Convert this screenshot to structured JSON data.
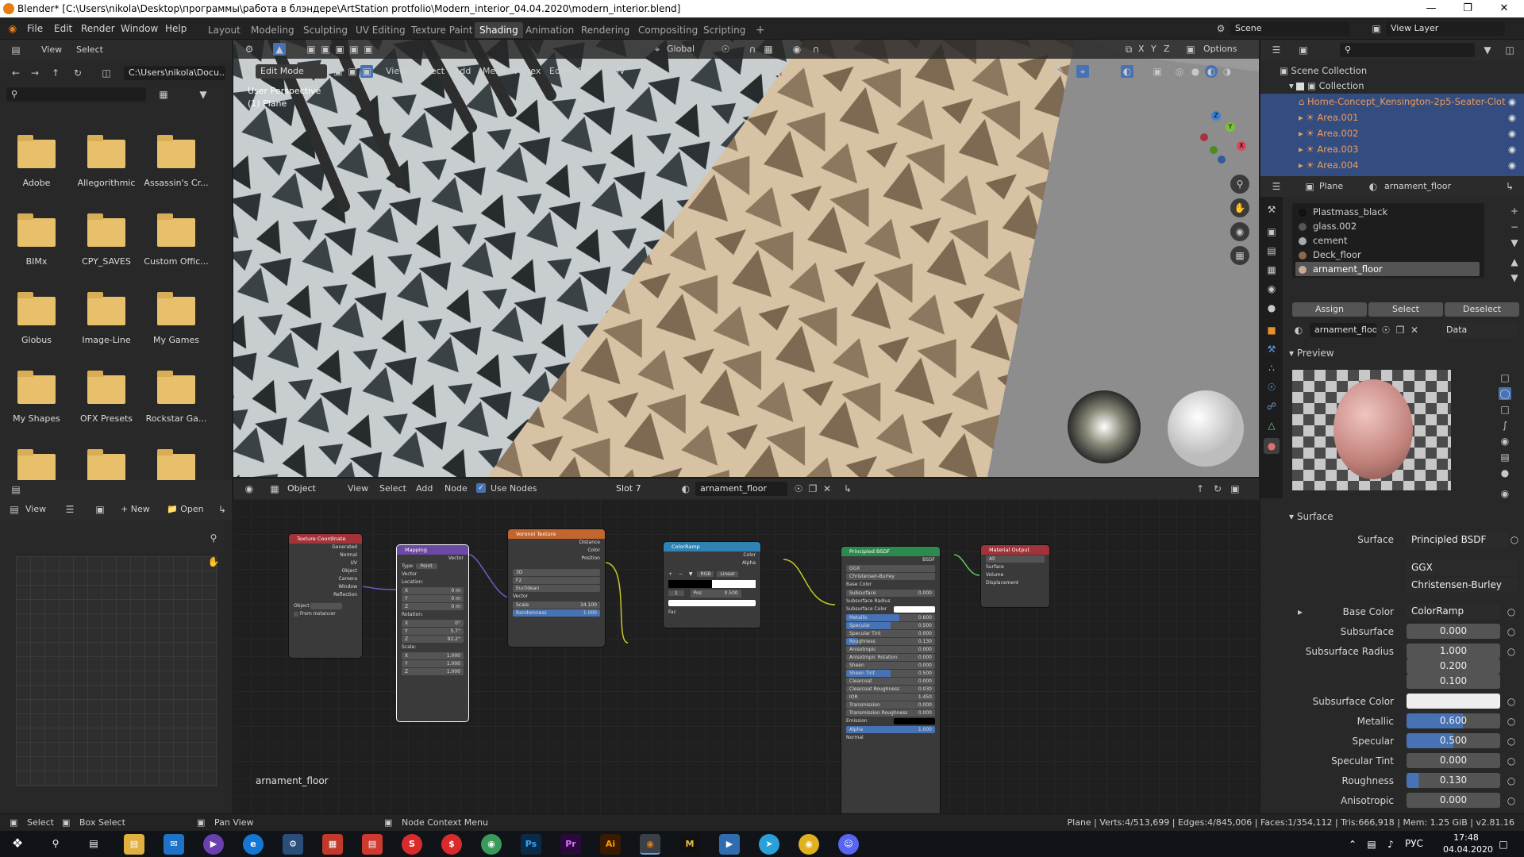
{
  "window": {
    "title": "Blender* [C:\\Users\\nikola\\Desktop\\программы\\работа в блэндере\\ArtStation protfolio\\Modern_interior_04.04.2020\\modern_interior.blend]",
    "min_icon": "minimize-icon",
    "max_icon": "maximize-icon",
    "close_icon": "close-icon"
  },
  "topbar": {
    "menus": [
      "File",
      "Edit",
      "Render",
      "Window",
      "Help"
    ],
    "workspaces": [
      "Layout",
      "Modeling",
      "Sculpting",
      "UV Editing",
      "Texture Paint",
      "Shading",
      "Animation",
      "Rendering",
      "Compositing",
      "Scripting"
    ],
    "active_workspace": "Shading",
    "add_tab": "+",
    "scene_label": "Scene",
    "viewlayer_label": "View Layer"
  },
  "filebrowser": {
    "menus": [
      "View",
      "Select"
    ],
    "path": "C:\\Users\\nikola\\Docu...",
    "folders": [
      "Adobe",
      "Allegorithmic",
      "Assassin's Cr...",
      "BIMx",
      "CPY_SAVES",
      "Custom Offic...",
      "Globus",
      "Image-Line",
      "My Games",
      "My Shapes",
      "OFX Presets",
      "Rockstar Ga...",
      "",
      "",
      ""
    ]
  },
  "viewport": {
    "mode": "Edit Mode",
    "menus": [
      "View",
      "Select",
      "Add",
      "Mesh",
      "Vertex",
      "Edge",
      "Face",
      "UV"
    ],
    "transform": "Global",
    "options": "Options",
    "overlay_text1": "User Perspective",
    "overlay_text2": "(1) Plane",
    "gizmo_axes": [
      "X",
      "Y",
      "Z"
    ]
  },
  "imageeditor": {
    "view": "View",
    "new": "New",
    "open": "Open"
  },
  "nodeeditor": {
    "object_mode": "Object",
    "menus": [
      "View",
      "Select",
      "Add",
      "Node"
    ],
    "use_nodes": "Use Nodes",
    "slot": "Slot 7",
    "material": "arnament_floor",
    "footer_label": "arnament_floor",
    "nodes": {
      "texcoord": {
        "title": "Texture Coordinate",
        "outputs": [
          "Generated",
          "Normal",
          "UV",
          "Object",
          "Camera",
          "Window",
          "Reflection"
        ],
        "object_label": "Object",
        "from_instancer": "From Instancer"
      },
      "mapping": {
        "title": "Mapping",
        "output": "Vector",
        "type_label": "Type:",
        "type_value": "Point",
        "vector": "Vector",
        "location": "Location:",
        "loc": [
          [
            "X",
            "0 m"
          ],
          [
            "Y",
            "0 m"
          ],
          [
            "Z",
            "0 m"
          ]
        ],
        "rotation": "Rotation:",
        "rot": [
          [
            "X",
            "0°"
          ],
          [
            "Y",
            "5.7°"
          ],
          [
            "Z",
            "92.2°"
          ]
        ],
        "scale": "Scale:",
        "scl": [
          [
            "X",
            "1.000"
          ],
          [
            "Y",
            "1.000"
          ],
          [
            "Z",
            "1.000"
          ]
        ]
      },
      "voronoi": {
        "title": "Voronoi Texture",
        "outputs": [
          "Distance",
          "Color",
          "Position"
        ],
        "dim": "3D",
        "feature": "F2",
        "metric": "Euclidean",
        "vector": "Vector",
        "scale_label": "Scale",
        "scale_value": "34.100",
        "random_label": "Randomness",
        "random_value": "1.000"
      },
      "colorramp": {
        "title": "ColorRamp",
        "outputs": [
          "Color",
          "Alpha"
        ],
        "add": "+",
        "remove": "−",
        "mode": "RGB",
        "interp": "Linear",
        "index": "1",
        "pos_label": "Pos",
        "pos_value": "0.500",
        "fac": "Fac"
      },
      "bsdf": {
        "title": "Principled BSDF",
        "output": "BSDF",
        "dist": "GGX",
        "sss": "Christensen-Burley",
        "rows": [
          [
            "Base Color",
            ""
          ],
          [
            "Subsurface",
            "0.000"
          ],
          [
            "Subsurface Radius",
            ""
          ],
          [
            "Subsurface Color",
            ""
          ],
          [
            "Metallic",
            "0.600"
          ],
          [
            "Specular",
            "0.500"
          ],
          [
            "Specular Tint",
            "0.000"
          ],
          [
            "Roughness",
            "0.130"
          ],
          [
            "Anisotropic",
            "0.000"
          ],
          [
            "Anisotropic Rotation",
            "0.000"
          ],
          [
            "Sheen",
            "0.000"
          ],
          [
            "Sheen Tint",
            "0.500"
          ],
          [
            "Clearcoat",
            "0.000"
          ],
          [
            "Clearcoat Roughness",
            "0.030"
          ],
          [
            "IOR",
            "1.450"
          ],
          [
            "Transmission",
            "0.000"
          ],
          [
            "Transmission Roughness",
            "0.000"
          ],
          [
            "Emission",
            ""
          ],
          [
            "Alpha",
            "1.000"
          ],
          [
            "Normal",
            ""
          ]
        ]
      },
      "output": {
        "title": "Material Output",
        "target": "All",
        "inputs": [
          "Surface",
          "Volume",
          "Displacement"
        ]
      }
    }
  },
  "outliner": {
    "scene_collection": "Scene Collection",
    "collection": "Collection",
    "items": [
      "Home-Concept_Kensington-2p5-Seater-Clot",
      "Area.001",
      "Area.002",
      "Area.003",
      "Area.004"
    ]
  },
  "properties": {
    "object": "Plane",
    "material": "arnament_floor",
    "slots": [
      "Plastmass_black",
      "glass.002",
      "cement",
      "Deck_floor",
      "arnament_floor"
    ],
    "assign": "Assign",
    "select": "Select",
    "deselect": "Deselect",
    "mat_name": "arnament_floor",
    "data": "Data",
    "preview": "Preview",
    "surface_panel": "Surface",
    "surface_label": "Surface",
    "surface_value": "Principled BSDF",
    "dist": "GGX",
    "sss_method": "Christensen-Burley",
    "rows": [
      {
        "label": "Base Color",
        "value": "ColorRamp"
      },
      {
        "label": "Subsurface",
        "value": "0.000"
      },
      {
        "label": "Subsurface Radius",
        "value": "1.000"
      },
      {
        "label": "",
        "value": "0.200"
      },
      {
        "label": "",
        "value": "0.100"
      },
      {
        "label": "Subsurface Color",
        "value": ""
      },
      {
        "label": "Metallic",
        "value": "0.600",
        "fill": 0.6
      },
      {
        "label": "Specular",
        "value": "0.500",
        "fill": 0.5
      },
      {
        "label": "Specular Tint",
        "value": "0.000"
      },
      {
        "label": "Roughness",
        "value": "0.130",
        "fill": 0.13
      },
      {
        "label": "Anisotropic",
        "value": "0.000"
      }
    ]
  },
  "statusbar": {
    "select": "Select",
    "box_select": "Box Select",
    "pan_view": "Pan View",
    "node_context": "Node Context Menu",
    "stats": "Plane | Verts:4/513,699 | Edges:4/845,006 | Faces:1/354,112 | Tris:666,918 | Mem: 1.25 GiB | v2.81.16"
  },
  "taskbar": {
    "time": "17:48",
    "date": "04.04.2020",
    "lang": "РУС",
    "apps": [
      "Ps",
      "Pr",
      "Ai",
      "M"
    ]
  },
  "colors": {
    "accent": "#4772b3",
    "header": "#2b2b2b",
    "orange": "#e87d0d",
    "outliner_sel": "#334d80"
  }
}
